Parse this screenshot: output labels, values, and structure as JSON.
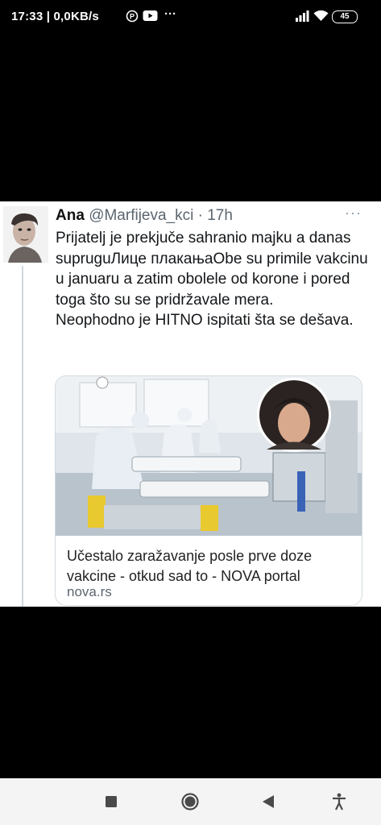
{
  "status_bar": {
    "time_speed": "17:33 | 0,0KB/s",
    "overflow": "···",
    "battery": "45",
    "icons": [
      "pinterest-icon",
      "youtube-icon",
      "signal-icon",
      "wifi-icon",
      "battery-icon"
    ]
  },
  "tweet": {
    "author_name": "Ana",
    "handle_time": "@Marfijeva_kci · 17h",
    "more": "···",
    "text_line_1": "Prijatelj je prekjuče sahranio majku a danas supruguЛице плакањаObe su primile vakcinu u januaru a zatim obolele od korone i pored toga što su se pridržavale mera.",
    "text_line_2": "Neophodno je HITNO ispitati šta se dešava.",
    "card": {
      "title": "Učestalo zaražavanje posle prve doze vakcine - otkud sad to - NOVA portal",
      "domain": "nova.rs"
    }
  },
  "nav_bar": {
    "icons": [
      "recents-square-icon",
      "home-circle-icon",
      "back-triangle-icon",
      "accessibility-icon"
    ]
  },
  "colors": {
    "background": "#000000",
    "tweet_background": "#ffffff",
    "secondary_text": "#5b6670",
    "card_border": "#d4dbe0"
  }
}
